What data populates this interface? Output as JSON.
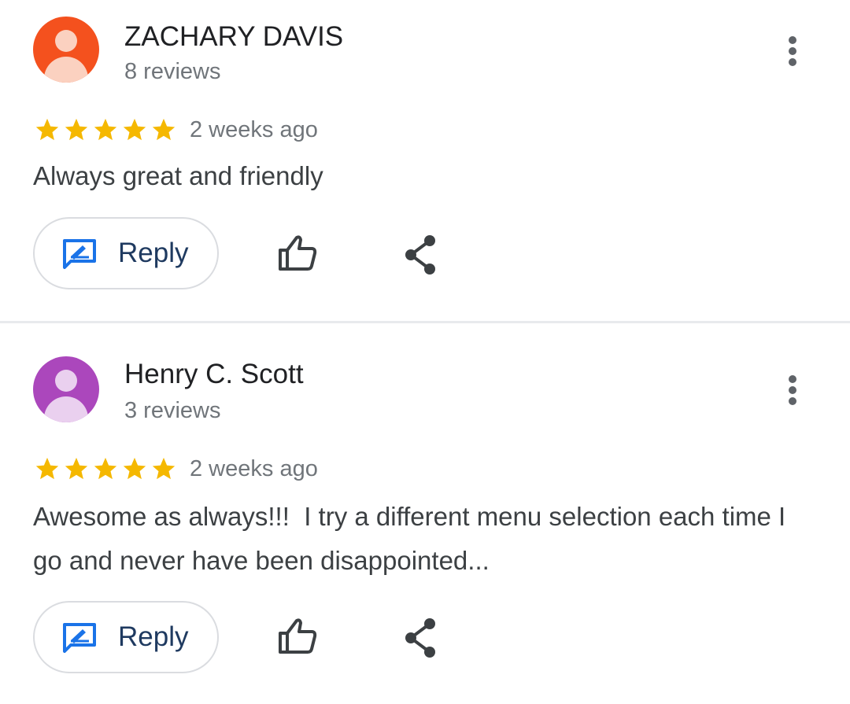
{
  "icons": {
    "avatar": "person-icon",
    "more": "more-vert-icon",
    "star": "star-icon",
    "reply": "reply-icon",
    "like": "thumb-up-icon",
    "share": "share-icon"
  },
  "colors": {
    "star": "#f5b800",
    "reply_icon": "#1a73e8",
    "avatar_1_bg": "#f4511e",
    "avatar_1_fg": "#fbd1c0",
    "avatar_2_bg": "#ab47bc",
    "avatar_2_fg": "#ead0ef"
  },
  "reviews": [
    {
      "author": "ZACHARY DAVIS",
      "review_count": "8 reviews",
      "rating": 5,
      "time": "2 weeks ago",
      "text": "Always great and friendly",
      "reply_label": "Reply"
    },
    {
      "author": "Henry C. Scott",
      "review_count": "3 reviews",
      "rating": 5,
      "time": "2 weeks ago",
      "text": "Awesome as always!!!  I try a different menu selection each time I go and never have been disappointed...",
      "reply_label": "Reply"
    }
  ]
}
